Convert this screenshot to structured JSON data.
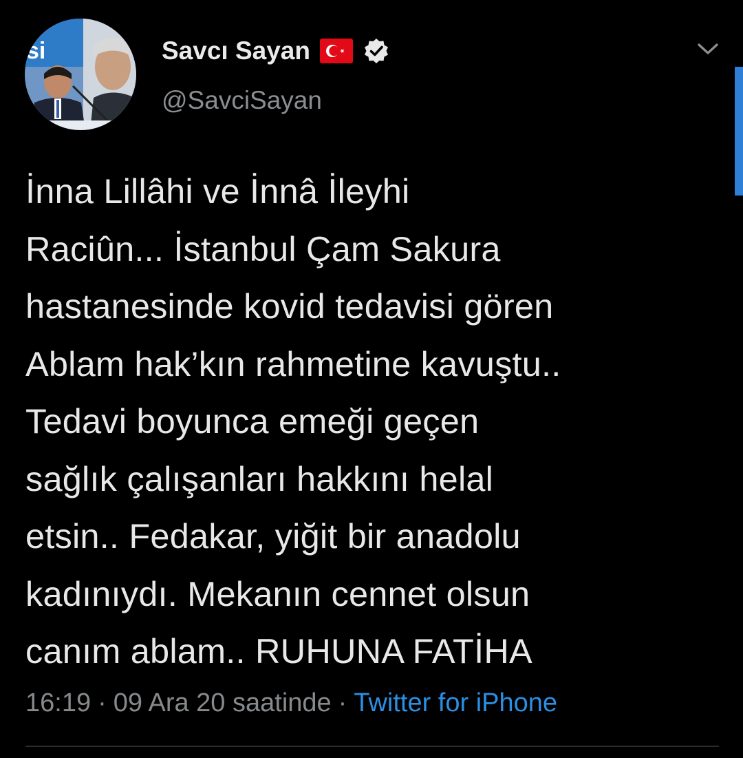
{
  "tweet": {
    "display_name": "Savcı Sayan",
    "handle": "@SavciSayan",
    "text": "İnna Lillâhi ve İnnâ İleyhi\nRaciûn... İstanbul Çam Sakura\nhastanesinde kovid tedavisi gören\nAblam hak’kın rahmetine kavuştu..\nTedavi boyunca emeği geçen\nsağlık çalışanları hakkını helal\netsin.. Fedakar, yiğit bir anadolu\nkadınıydı. Mekanın cennet olsun\ncanım ablam.. RUHUNA FATİHA",
    "time": "16:19",
    "separator": "·",
    "date": "09 Ara 20 saatinde",
    "source": "Twitter for iPhone",
    "avatar_banner_text": "si"
  },
  "icons": {
    "flag": "turkey-flag-icon",
    "verified": "verified-badge-icon",
    "menu": "chevron-down-icon"
  },
  "colors": {
    "background": "#000000",
    "text": "#e8e8e8",
    "secondary": "#878a8d",
    "link": "#2b8fe3",
    "flag_red": "#e30a17",
    "scrollbar": "#2f7fd6"
  }
}
